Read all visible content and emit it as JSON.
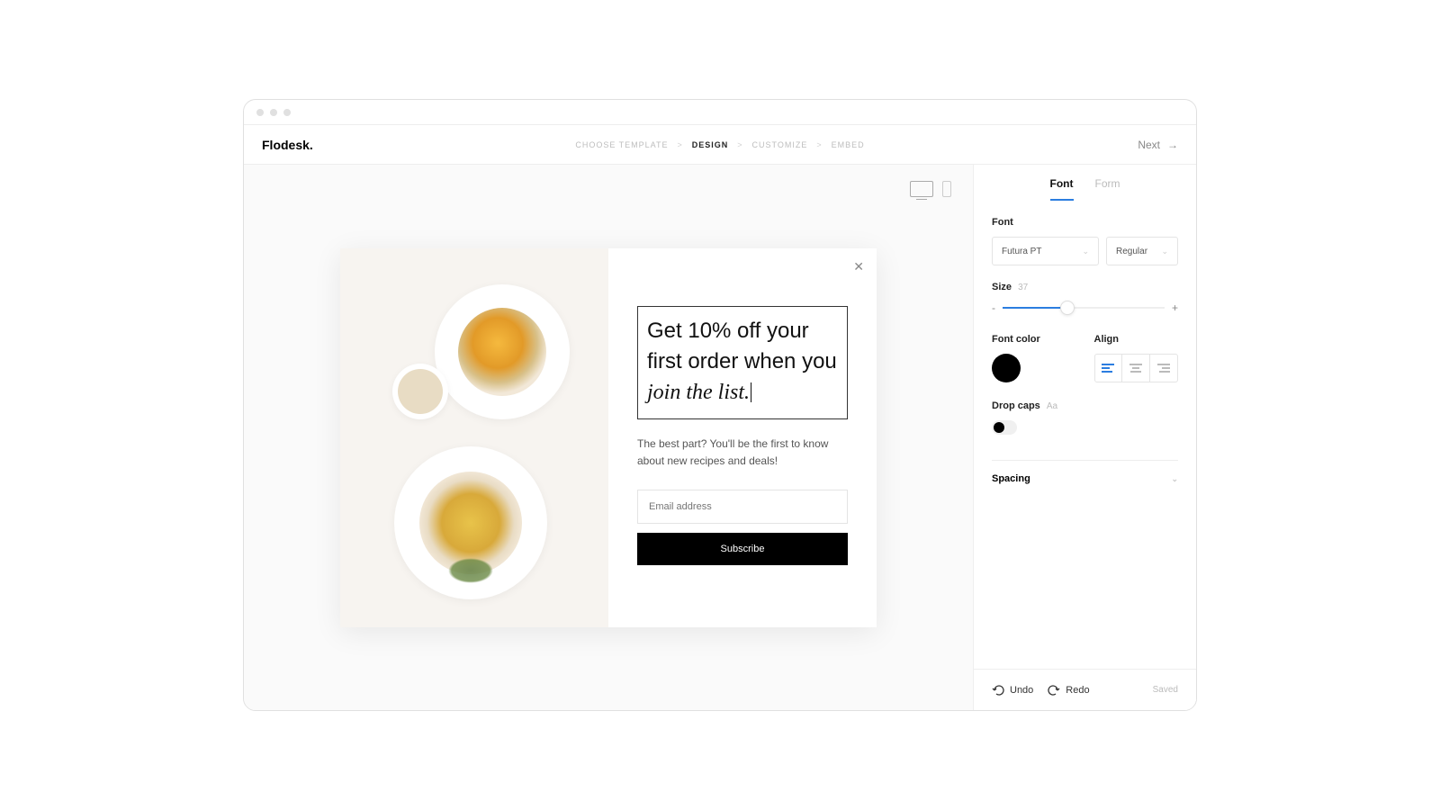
{
  "logo": "Flodesk.",
  "breadcrumb": {
    "step1": "CHOOSE TEMPLATE",
    "step2": "DESIGN",
    "step3": "CUSTOMIZE",
    "step4": "EMBED"
  },
  "next_button": "Next",
  "popup": {
    "headline_plain": "Get 10% off your first order when you ",
    "headline_italic": "join the list.",
    "subtext": "The best part? You'll be the first to know about new recipes and deals!",
    "email_placeholder": "Email address",
    "subscribe_button": "Subscribe"
  },
  "sidebar": {
    "tabs": {
      "font": "Font",
      "form": "Form"
    },
    "font_section_label": "Font",
    "font_family": "Futura PT",
    "font_weight": "Regular",
    "size_label": "Size",
    "size_value": "37",
    "minus": "-",
    "plus": "+",
    "font_color_label": "Font color",
    "font_color_value": "#000000",
    "align_label": "Align",
    "drop_caps_label": "Drop caps",
    "drop_caps_hint": "Aa",
    "spacing_label": "Spacing"
  },
  "footer": {
    "undo": "Undo",
    "redo": "Redo",
    "saved": "Saved"
  }
}
